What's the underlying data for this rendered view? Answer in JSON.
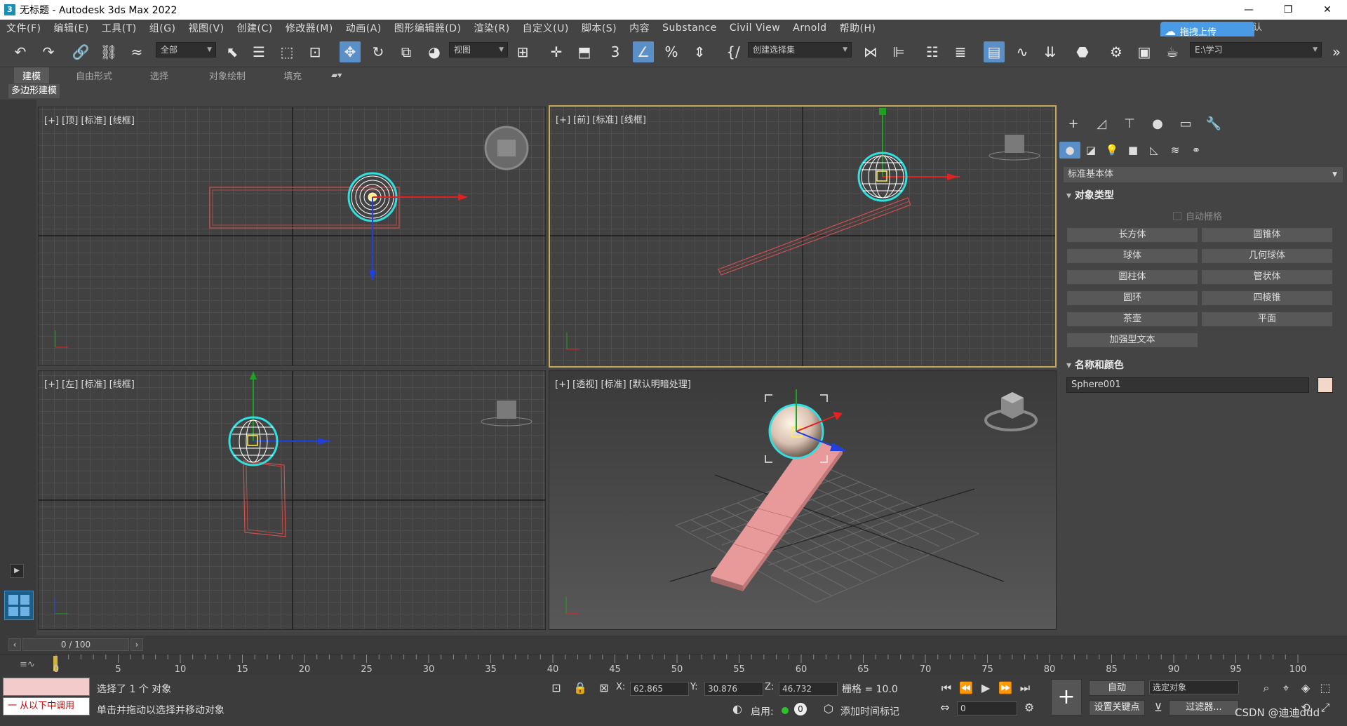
{
  "titlebar": {
    "title": "无标题 - Autodesk 3ds Max 2022",
    "minimize": "—",
    "maximize": "❐",
    "close": "✕"
  },
  "menu": [
    "文件(F)",
    "编辑(E)",
    "工具(T)",
    "组(G)",
    "视图(V)",
    "创建(C)",
    "修改器(M)",
    "动画(A)",
    "图形编辑器(D)",
    "渲染(R)",
    "自定义(U)",
    "脚本(S)",
    "内容",
    "Substance",
    "Civil View",
    "Arnold",
    "帮助(H)"
  ],
  "upload": {
    "label": "拖拽上传"
  },
  "workspace": {
    "label": "认"
  },
  "toolbar": {
    "selection_filter": "全部",
    "reference_coord": "视图",
    "named_selection": "创建选择集",
    "project_path": "E:\\学习"
  },
  "ribbon": {
    "tabs": [
      "建模",
      "自由形式",
      "选择",
      "对象绘制",
      "填充"
    ],
    "sub": "多边形建模"
  },
  "viewports": {
    "top": {
      "label": "[+] [顶] [标准] [线框]"
    },
    "front": {
      "label": "[+] [前] [标准] [线框]"
    },
    "left": {
      "label": "[+] [左] [标准] [线框]"
    },
    "persp": {
      "label": "[+] [透视] [标准] [默认明暗处理]"
    }
  },
  "command_panel": {
    "category": "标准基本体",
    "object_type_title": "对象类型",
    "autogrid": "自动栅格",
    "buttons": [
      "长方体",
      "圆锥体",
      "球体",
      "几何球体",
      "圆柱体",
      "管状体",
      "圆环",
      "四棱锥",
      "茶壶",
      "平面",
      "加强型文本"
    ],
    "name_color_title": "名称和颜色",
    "object_name": "Sphere001",
    "object_color": "#f2d8c8"
  },
  "timeline": {
    "position": "0 / 100",
    "ticks": [
      "0",
      "5",
      "10",
      "15",
      "20",
      "25",
      "30",
      "35",
      "40",
      "45",
      "50",
      "55",
      "60",
      "65",
      "70",
      "75",
      "80",
      "85",
      "90",
      "95",
      "100"
    ]
  },
  "status": {
    "selected": "选择了 1 个 对象",
    "prompt": "单击并拖动以选择并移动对象",
    "maxscript": "一 从以下中调用",
    "x_label": "X:",
    "x": "62.865",
    "y_label": "Y:",
    "y": "30.876",
    "z_label": "Z:",
    "z": "46.732",
    "grid": "栅格 = 10.0",
    "enable": "启用:",
    "add_time_tag": "添加时间标记",
    "auto_key": "自动",
    "set_key": "设置关键点",
    "selection_set": "选定对象",
    "filters": "过滤器...",
    "frame": "0",
    "watermark": "CSDN @迪迪ddd"
  },
  "colors": {
    "accent": "#5b8fc7",
    "active_viewport_border": "#c8a85a",
    "plank": "#e89a9a",
    "gizmo_x": "#e52020",
    "gizmo_y": "#20a020",
    "gizmo_z": "#2040e0"
  }
}
